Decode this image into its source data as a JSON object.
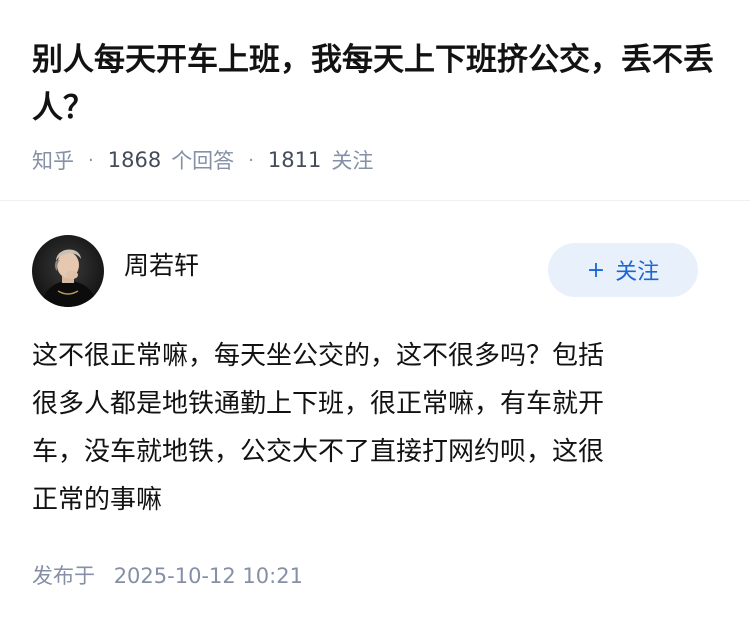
{
  "question": {
    "title": "别人每天开车上班，我每天上下班挤公交，丢不丢人？"
  },
  "meta": {
    "source": "知乎",
    "answer_count": "1868",
    "answer_label": "个回答",
    "follower_count": "1811",
    "follower_label": "关注"
  },
  "author": {
    "name": "周若轩",
    "follow_label": "关注",
    "follow_icon": "plus-icon"
  },
  "answer": {
    "lines": [
      "这不很正常嘛，每天坐公交的，这不很多吗？包括",
      "很多人都是地铁通勤上下班，很正常嘛，有车就开",
      "车，没车就地铁，公交大不了直接打网约呗，这很",
      "正常的事嘛"
    ]
  },
  "publish": {
    "label": "发布于",
    "datetime": "2025-10-12 10:21"
  },
  "colors": {
    "title": "#121212",
    "meta": "#8590a6",
    "accent": "#1a66d6",
    "follow_bg": "#e8f1fb"
  }
}
